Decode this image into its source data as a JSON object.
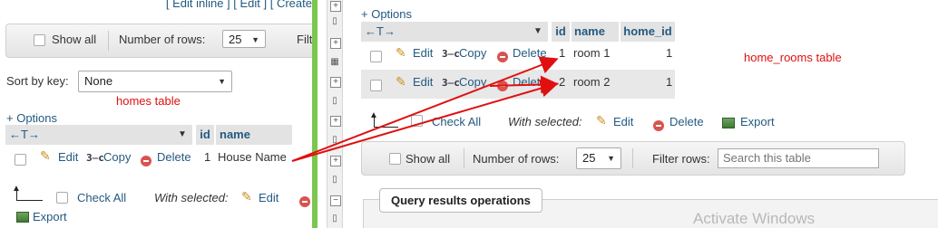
{
  "left": {
    "top_links": "[ Edit inline ] [ Edit ] [ Create",
    "nav": {
      "show_all": "Show all",
      "rows_label": "Number of rows:",
      "rows_value": "25",
      "filter_label": "Filt"
    },
    "sort_label": "Sort by key:",
    "sort_value": "None",
    "annotation": "homes table",
    "options": "+ Options",
    "table": {
      "col_arrows": "←T→",
      "headers": {
        "id": "id",
        "name": "name"
      },
      "rows": [
        {
          "edit": "Edit",
          "copy": "Copy",
          "delete": "Delete",
          "id": "1",
          "name": "House Name"
        }
      ]
    },
    "bottom": {
      "check_all": "Check All",
      "with_selected": "With selected:",
      "edit": "Edit",
      "export": "Export"
    }
  },
  "right": {
    "options": "+ Options",
    "annotation": "home_rooms table",
    "table": {
      "col_arrows": "←T→",
      "headers": {
        "id": "id",
        "name": "name",
        "home_id": "home_id"
      },
      "rows": [
        {
          "edit": "Edit",
          "copy": "Copy",
          "delete": "Delete",
          "id": "1",
          "name": "room 1",
          "home_id": "1"
        },
        {
          "edit": "Edit",
          "copy": "Copy",
          "delete": "Delete",
          "id": "2",
          "name": "room 2",
          "home_id": "1"
        }
      ]
    },
    "bottom": {
      "check_all": "Check All",
      "with_selected": "With selected:",
      "edit": "Edit",
      "delete": "Delete",
      "export": "Export"
    },
    "nav": {
      "show_all": "Show all",
      "rows_label": "Number of rows:",
      "rows_value": "25",
      "filter_label": "Filter rows:",
      "filter_placeholder": "Search this table"
    },
    "query_ops": "Query results operations",
    "watermark": "Activate Windows"
  },
  "colors": {
    "annotation_red": "#e01010",
    "link_blue": "#235a81",
    "divider_green": "#7bc74d"
  }
}
